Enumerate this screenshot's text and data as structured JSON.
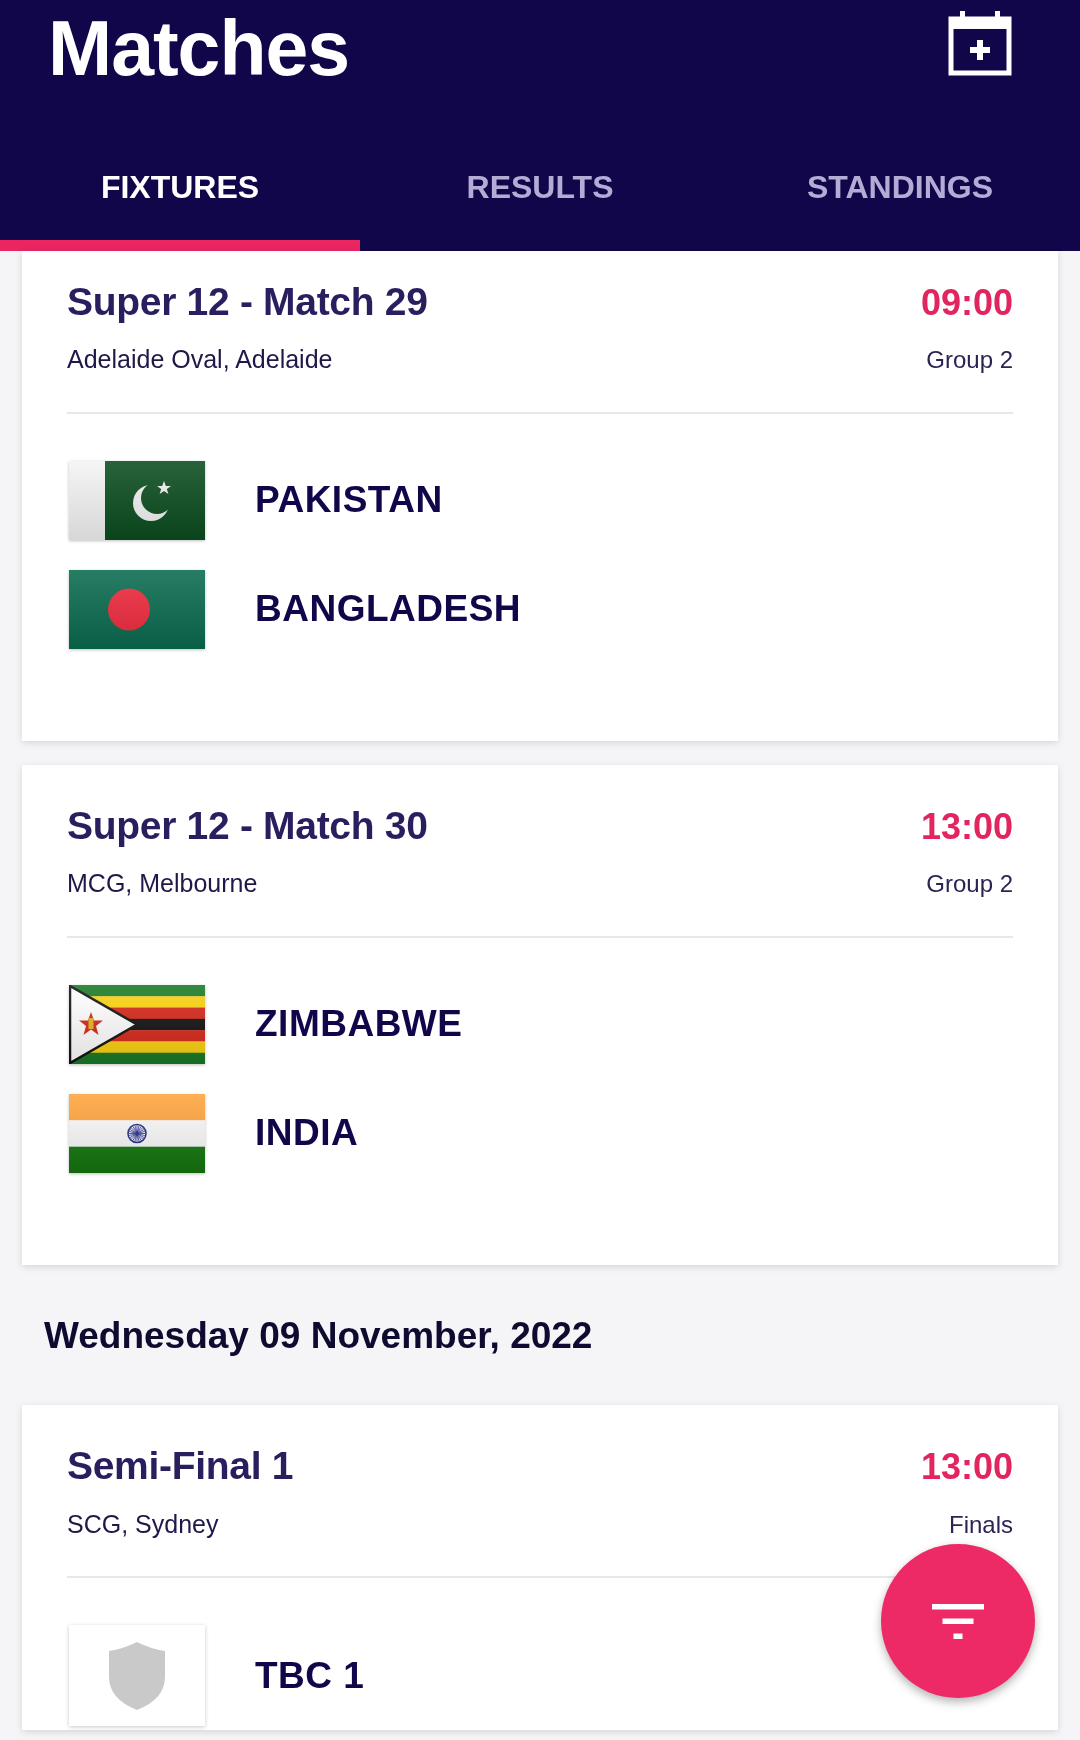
{
  "header": {
    "title": "Matches"
  },
  "tabs": [
    {
      "label": "FIXTURES",
      "selected": true
    },
    {
      "label": "RESULTS",
      "selected": false
    },
    {
      "label": "STANDINGS",
      "selected": false
    }
  ],
  "fixtures": [
    {
      "kind": "match",
      "title": "Super 12 - Match 29",
      "time": "09:00",
      "venue": "Adelaide Oval, Adelaide",
      "group": "Group 2",
      "teams": [
        {
          "name": "PAKISTAN",
          "kind": "pakistan"
        },
        {
          "name": "BANGLADESH",
          "kind": "bangladesh"
        }
      ]
    },
    {
      "kind": "match",
      "title": "Super 12 - Match 30",
      "time": "13:00",
      "venue": "MCG, Melbourne",
      "group": "Group 2",
      "teams": [
        {
          "name": "ZIMBABWE",
          "kind": "zimbabwe"
        },
        {
          "name": "INDIA",
          "kind": "india"
        }
      ]
    },
    {
      "kind": "date",
      "text": "Wednesday 09 November, 2022"
    },
    {
      "kind": "match",
      "title": "Semi-Final 1",
      "time": "13:00",
      "venue": "SCG, Sydney",
      "group": "Finals",
      "teams": [
        {
          "name": "TBC 1",
          "kind": "placeholder"
        }
      ]
    }
  ]
}
